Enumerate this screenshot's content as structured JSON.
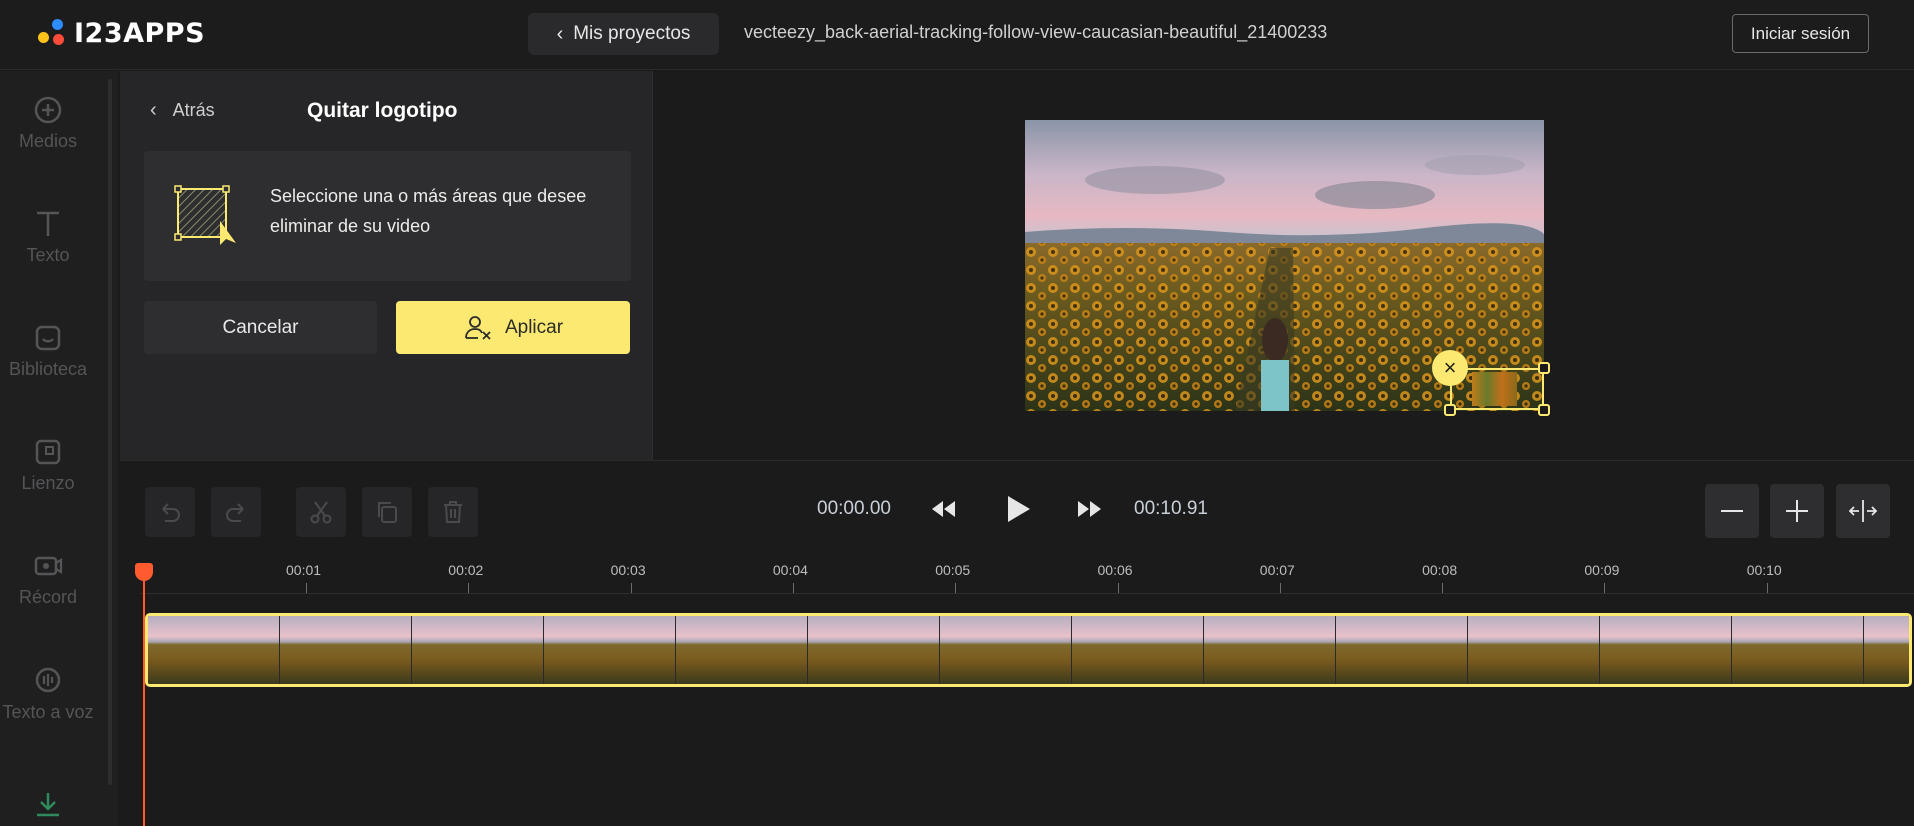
{
  "header": {
    "logo_text": "I23APPS",
    "back_label": "Mis proyectos",
    "filename": "vecteezy_back-aerial-tracking-follow-view-caucasian-beautiful_21400233",
    "login_label": "Iniciar sesión"
  },
  "sidebar": {
    "items": [
      {
        "label": "Medios",
        "icon": "plus-circle-icon"
      },
      {
        "label": "Texto",
        "icon": "text-icon"
      },
      {
        "label": "Biblioteca",
        "icon": "sticker-icon"
      },
      {
        "label": "Lienzo",
        "icon": "canvas-icon"
      },
      {
        "label": "Récord",
        "icon": "record-icon"
      },
      {
        "label": "Texto a voz",
        "icon": "tts-icon"
      },
      {
        "label": "",
        "icon": "download-icon"
      }
    ]
  },
  "panel": {
    "back_label": "Atrás",
    "title": "Quitar logotipo",
    "instruction": "Seleccione una o más áreas que desee eliminar de su video",
    "cancel_label": "Cancelar",
    "apply_label": "Aplicar"
  },
  "player": {
    "current_time": "00:00.00",
    "total_time": "00:10.91"
  },
  "timeline": {
    "ruler": [
      "00:01",
      "00:02",
      "00:03",
      "00:04",
      "00:05",
      "00:06",
      "00:07",
      "00:08",
      "00:09",
      "00:10"
    ],
    "frame_count": 14
  },
  "colors": {
    "accent": "#fce971",
    "playhead": "#ff5b2e",
    "background": "#1b1b1c"
  }
}
